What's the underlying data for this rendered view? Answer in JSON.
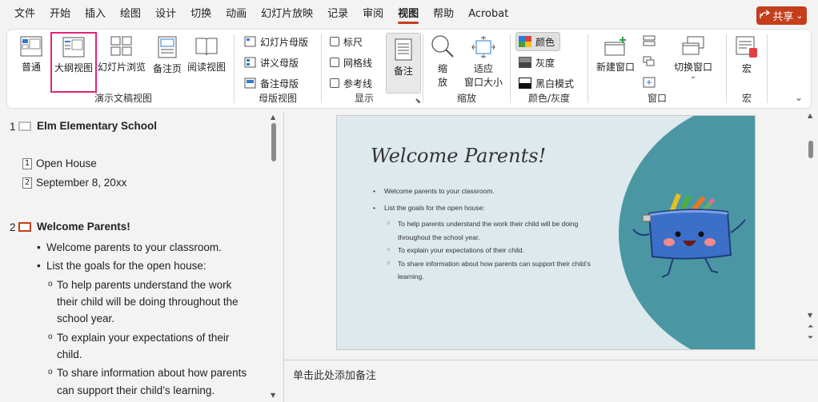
{
  "menu": {
    "tabs": [
      "文件",
      "开始",
      "插入",
      "绘图",
      "设计",
      "切换",
      "动画",
      "幻灯片放映",
      "记录",
      "审阅",
      "视图",
      "帮助",
      "Acrobat"
    ],
    "active_tab": "视图",
    "share_label": "共享"
  },
  "ribbon": {
    "presentation_views": {
      "label": "演示文稿视图",
      "normal": "普通",
      "outline": "大纲视图",
      "sorter": "幻灯片浏览",
      "notes_page": "备注页",
      "reading": "阅读视图"
    },
    "master_views": {
      "label": "母版视图",
      "slide_master": "幻灯片母版",
      "handout_master": "讲义母版",
      "notes_master": "备注母版"
    },
    "show": {
      "label": "显示",
      "ruler": "标尺",
      "gridlines": "网格线",
      "guides": "参考线",
      "notes": "备注"
    },
    "zoom": {
      "label": "缩放",
      "zoom_line1": "缩",
      "zoom_line2": "放",
      "fit_line1": "适应",
      "fit_line2": "窗口大小"
    },
    "color": {
      "label": "颜色/灰度",
      "color": "颜色",
      "grayscale": "灰度",
      "bw": "黑白模式"
    },
    "window": {
      "label": "窗口",
      "new_window": "新建窗口",
      "switch_windows": "切换窗口"
    },
    "macros": {
      "label": "宏",
      "macros": "宏"
    }
  },
  "outline": {
    "slides": [
      {
        "number": "1",
        "title": "Elm Elementary School",
        "subitems": [
          {
            "num": "1",
            "text": "Open House"
          },
          {
            "num": "2",
            "text": "September 8, 20xx"
          }
        ]
      },
      {
        "number": "2",
        "title": "Welcome Parents!",
        "bullets": [
          "Welcome parents to your classroom.",
          "List the goals for the open house:"
        ],
        "subbullets": [
          [
            "To help parents understand the work",
            "their child will be doing throughout the",
            "school year."
          ],
          [
            "To explain your expectations of their",
            "child."
          ],
          [
            "To share information about how parents",
            "can support their child’s learning."
          ]
        ]
      }
    ]
  },
  "slide": {
    "title": "Welcome Parents!",
    "bullets": [
      "Welcome parents to your classroom.",
      "List the goals for the open house:"
    ],
    "subbullets": [
      "To help parents understand the work their child will be doing throughout the school year.",
      "To explain your expectations of their child.",
      "To share information about how parents can support their child’s learning."
    ]
  },
  "notes": {
    "placeholder": "单击此处添加备注"
  },
  "colors": {
    "accent": "#c43e1c",
    "slide_bg": "#dde9ec",
    "slide_circle": "#4a97a3",
    "highlight_outline": "#e0247a"
  }
}
